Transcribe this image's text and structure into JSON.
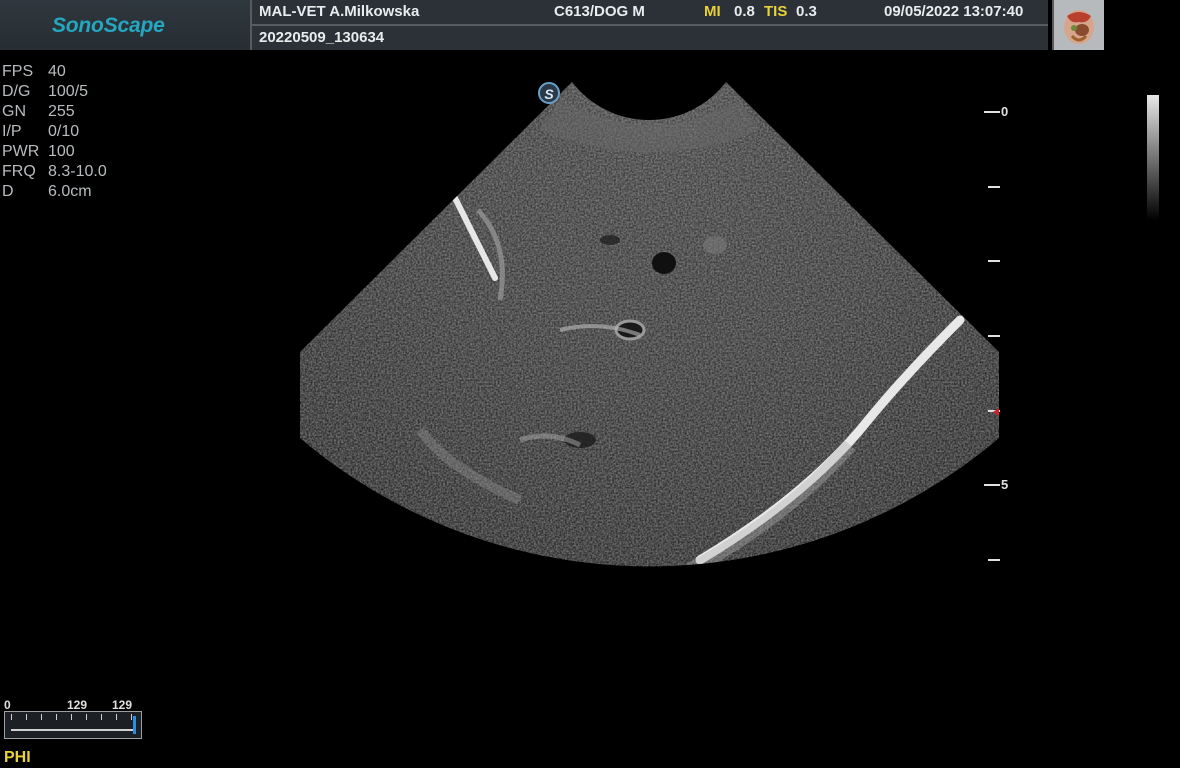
{
  "brand": {
    "logo_text": "SonoScape"
  },
  "header": {
    "institution": "MAL-VET A.Milkowska",
    "probe_preset": "C613/DOG M",
    "mi_label": "MI",
    "mi_value": "0.8",
    "tis_label": "TIS",
    "tis_value": "0.3",
    "datetime": "09/05/2022 13:07:40",
    "study_id": "20220509_130634",
    "organ_icon": "abdomen-organ-icon"
  },
  "params": [
    {
      "key": "FPS",
      "value": "40"
    },
    {
      "key": "D/G",
      "value": "100/5"
    },
    {
      "key": "GN",
      "value": "255"
    },
    {
      "key": "I/P",
      "value": "0/10"
    },
    {
      "key": "PWR",
      "value": "100"
    },
    {
      "key": "FRQ",
      "value": "8.3-10.0"
    },
    {
      "key": "D",
      "value": "6.0cm"
    }
  ],
  "depth_scale": {
    "label_0": "0",
    "label_5": "5"
  },
  "probe_marker": {
    "glyph": "S"
  },
  "map_bar": {
    "label_min": "0",
    "label_mid": "129",
    "label_max": "129"
  },
  "mode_label": "PHI",
  "colors": {
    "logo": "#24a7c0",
    "header_bg": "#2b3136",
    "highlight": "#e8d23a",
    "focus_marker": "#d0202a"
  }
}
